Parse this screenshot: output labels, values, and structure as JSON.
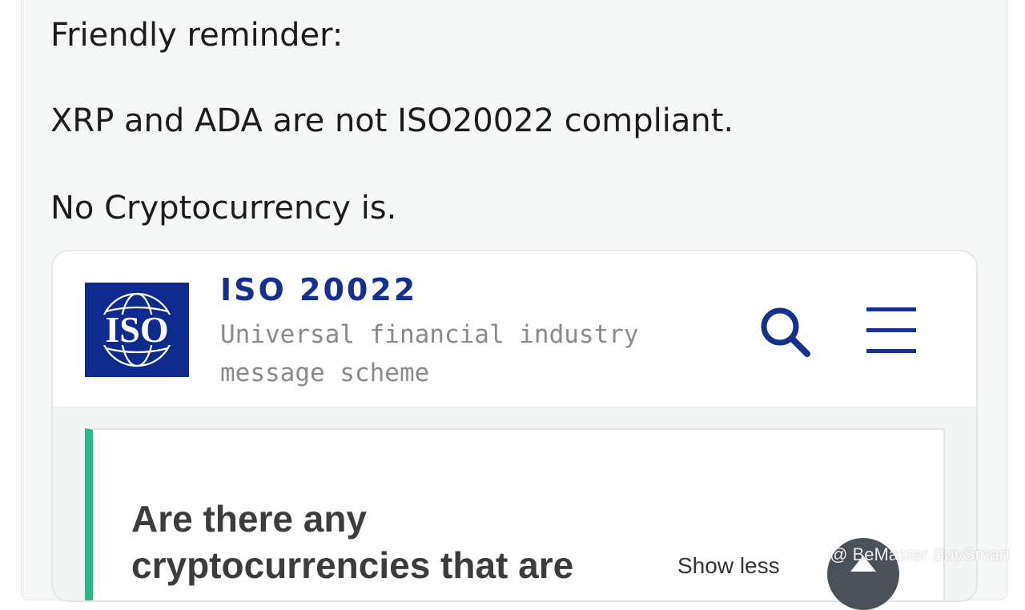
{
  "post": {
    "lines": [
      "Friendly reminder:",
      "XRP and ADA are not ISO20022 compliant.",
      "No Cryptocurrency is."
    ]
  },
  "iso_card": {
    "logo_text": "ISO",
    "title": "ISO 20022",
    "subtitle": "Universal financial industry message scheme",
    "search_icon": "search-icon",
    "menu_icon": "hamburger-menu-icon",
    "faq": {
      "question": "Are there any cryptocurrencies that are",
      "toggle_label": "Show less",
      "toggle_icon": "chevron-up-icon"
    }
  },
  "watermark": {
    "text": "@ BeMaster BuySmart",
    "icon": "binance-square-icon"
  },
  "colors": {
    "iso_blue": "#0d2a8f",
    "faq_accent": "#2ab887",
    "subtitle_gray": "#8a8a8a"
  }
}
